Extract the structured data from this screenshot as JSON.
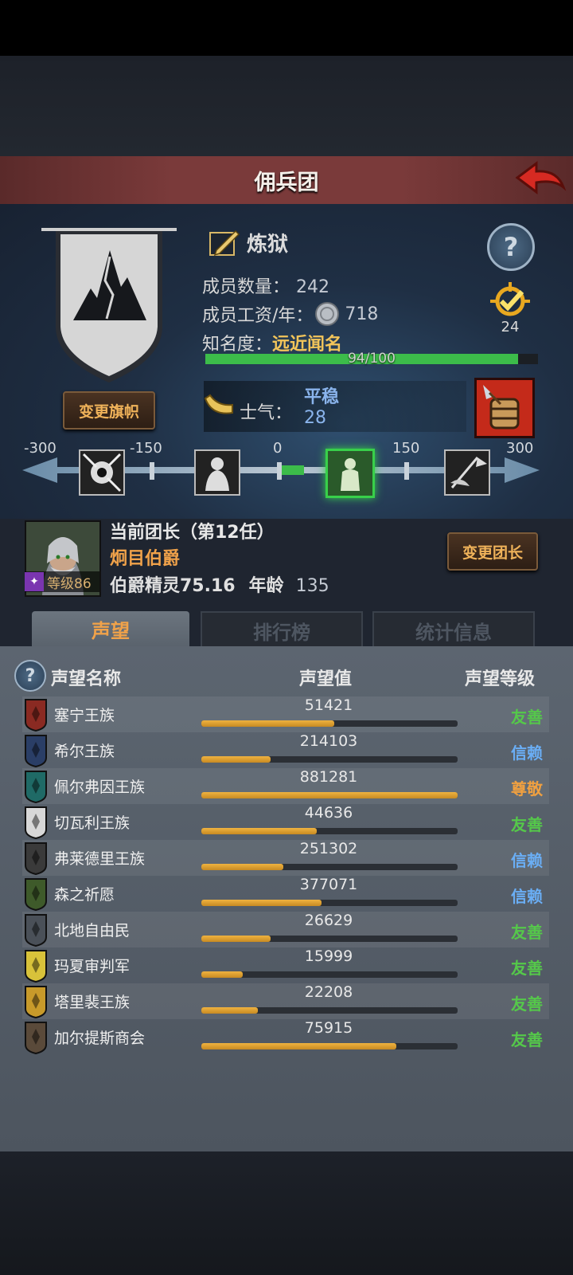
{
  "header": {
    "title": "佣兵团"
  },
  "company": {
    "name": "炼狱",
    "members_label": "成员数量：",
    "members_value": "242",
    "wage_label": "成员工资/年：",
    "wage_value": "718",
    "fame_label": "知名度：",
    "fame_value": "远近闻名",
    "fame_progress_text": "94/100",
    "fame_fraction": 0.94,
    "rank_badge_value": "24",
    "change_banner_label": "变更旗帜"
  },
  "morale": {
    "label": "士气：",
    "state": "平稳",
    "value": "28",
    "scale_ticks": [
      "-300",
      "-150",
      "0",
      "150",
      "300"
    ]
  },
  "leader": {
    "title": "当前团长（第12任）",
    "name": "炯目伯爵",
    "class_label": "伯爵精灵75.16",
    "age_label": "年龄",
    "age_value": "135",
    "level_text": "等级86",
    "change_leader_label": "变更团长"
  },
  "tabs": [
    {
      "label": "声望"
    },
    {
      "label": "排行榜"
    },
    {
      "label": "统计信息"
    }
  ],
  "table": {
    "col_name": "声望名称",
    "col_value": "声望值",
    "col_level": "声望等级",
    "rows": [
      {
        "name": "塞宁王族",
        "value": "51421",
        "fraction": 0.52,
        "level": "友善",
        "level_color": "#55c84a",
        "shield_color": "#8a2a22"
      },
      {
        "name": "希尔王族",
        "value": "214103",
        "fraction": 0.27,
        "level": "信赖",
        "level_color": "#6aaef5",
        "shield_color": "#2a3e66"
      },
      {
        "name": "佩尔弗因王族",
        "value": "881281",
        "fraction": 1.0,
        "level": "尊敬",
        "level_color": "#f0a040",
        "shield_color": "#1f6a66"
      },
      {
        "name": "切瓦利王族",
        "value": "44636",
        "fraction": 0.45,
        "level": "友善",
        "level_color": "#55c84a",
        "shield_color": "#d8d8d8"
      },
      {
        "name": "弗莱德里王族",
        "value": "251302",
        "fraction": 0.32,
        "level": "信赖",
        "level_color": "#6aaef5",
        "shield_color": "#3a3a3a"
      },
      {
        "name": "森之祈愿",
        "value": "377071",
        "fraction": 0.47,
        "level": "信赖",
        "level_color": "#6aaef5",
        "shield_color": "#3e5a2a"
      },
      {
        "name": "北地自由民",
        "value": "26629",
        "fraction": 0.27,
        "level": "友善",
        "level_color": "#55c84a",
        "shield_color": "#4a5058"
      },
      {
        "name": "玛夏审判军",
        "value": "15999",
        "fraction": 0.16,
        "level": "友善",
        "level_color": "#55c84a",
        "shield_color": "#d8c23a"
      },
      {
        "name": "塔里裴王族",
        "value": "22208",
        "fraction": 0.22,
        "level": "友善",
        "level_color": "#55c84a",
        "shield_color": "#c89a2a"
      },
      {
        "name": "加尔提斯商会",
        "value": "75915",
        "fraction": 0.76,
        "level": "友善",
        "level_color": "#55c84a",
        "shield_color": "#5a4a3a"
      }
    ]
  }
}
